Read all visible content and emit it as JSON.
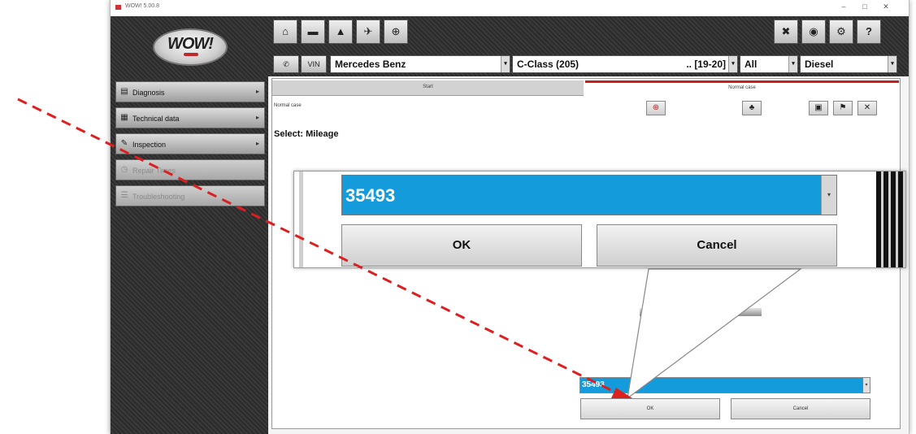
{
  "window": {
    "title": "WOW! 5.00.8",
    "minimize": "–",
    "maximize": "□",
    "close": "✕"
  },
  "logo": {
    "text": "WOW!"
  },
  "sidebar": {
    "items": [
      {
        "label": "Diagnosis",
        "icon": "diagnosis-icon",
        "glyph": "▤",
        "arrow": "▸"
      },
      {
        "label": "Technical data",
        "icon": "technical-data-icon",
        "glyph": "▦",
        "arrow": "▸"
      },
      {
        "label": "Inspection",
        "icon": "wrench-icon",
        "glyph": "✎",
        "arrow": "▸"
      },
      {
        "label": "Repair Times",
        "icon": "clock-icon",
        "glyph": "◷",
        "arrow": ""
      },
      {
        "label": "Troubleshooting",
        "icon": "troubleshooting-icon",
        "glyph": "☰",
        "arrow": ""
      }
    ]
  },
  "toolbar": {
    "home": "⌂",
    "car": "▬",
    "factory": "▲",
    "plane": "✈",
    "network": "⊕",
    "tools": "✖",
    "settings": "◉",
    "gear": "⚙",
    "help": "?"
  },
  "vehicle": {
    "phone": "✆",
    "vin": "VIN",
    "make": "Mercedes Benz",
    "model": "C-Class (205)",
    "years": ".. [19-20]",
    "type": "All",
    "fuel": "Diesel",
    "arrow": "▾"
  },
  "tabs": {
    "start": "Start",
    "normal": "Normal case"
  },
  "content": {
    "normal_label": "Normal case",
    "select_label": "Select: Mileage",
    "field_value": "35493",
    "ok": "OK",
    "cancel": "Cancel",
    "arrow": "▾"
  },
  "content_icons": {
    "alert": "⊕",
    "print": "♣",
    "save": "▣",
    "flag": "⚑",
    "close": "✕"
  },
  "zoom": {
    "field_value": "35493",
    "ok": "OK",
    "cancel": "Cancel",
    "arrow": "▾"
  },
  "colors": {
    "accent": "#139bdc",
    "tab_active": "#cc1e1e",
    "annotation": "#dd1f1f"
  }
}
